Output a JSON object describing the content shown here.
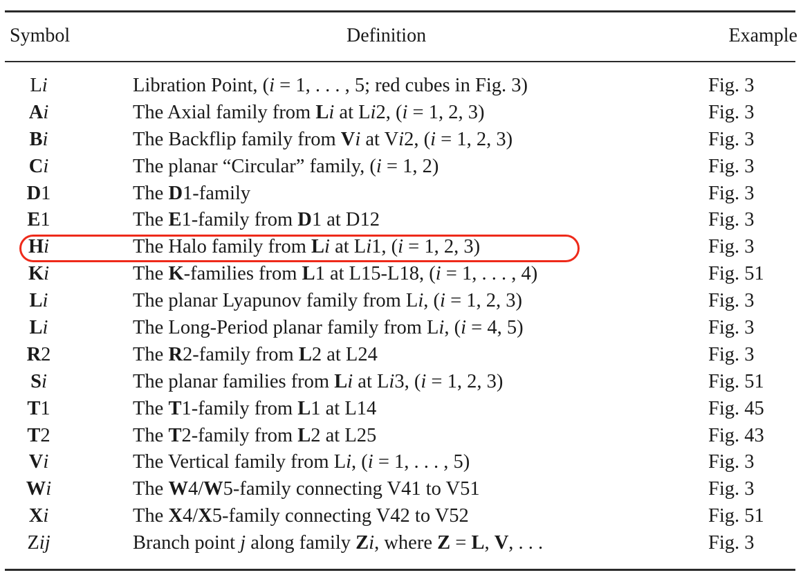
{
  "table": {
    "headers": {
      "symbol": "Symbol",
      "definition": "Definition",
      "example": "Example"
    },
    "highlight": {
      "row_index": 6,
      "color": "#ee2a1a"
    },
    "rows": [
      {
        "symbol": [
          {
            "t": "L",
            "s": "n"
          },
          {
            "t": "i",
            "s": "i"
          }
        ],
        "definition": [
          {
            "t": "Libration Point, (",
            "s": "n"
          },
          {
            "t": "i",
            "s": "i"
          },
          {
            "t": " = 1, . . . , 5; red cubes in Fig. 3)",
            "s": "n"
          }
        ],
        "example": "Fig. 3"
      },
      {
        "symbol": [
          {
            "t": "A",
            "s": "b"
          },
          {
            "t": "i",
            "s": "i"
          }
        ],
        "definition": [
          {
            "t": "The Axial family from ",
            "s": "n"
          },
          {
            "t": "L",
            "s": "b"
          },
          {
            "t": "i",
            "s": "i"
          },
          {
            "t": " at L",
            "s": "n"
          },
          {
            "t": "i",
            "s": "i"
          },
          {
            "t": "2, (",
            "s": "n"
          },
          {
            "t": "i",
            "s": "i"
          },
          {
            "t": " = 1, 2, 3)",
            "s": "n"
          }
        ],
        "example": "Fig. 3"
      },
      {
        "symbol": [
          {
            "t": "B",
            "s": "b"
          },
          {
            "t": "i",
            "s": "i"
          }
        ],
        "definition": [
          {
            "t": "The Backflip family from ",
            "s": "n"
          },
          {
            "t": "V",
            "s": "b"
          },
          {
            "t": "i",
            "s": "i"
          },
          {
            "t": " at V",
            "s": "n"
          },
          {
            "t": "i",
            "s": "i"
          },
          {
            "t": "2, (",
            "s": "n"
          },
          {
            "t": "i",
            "s": "i"
          },
          {
            "t": " = 1, 2, 3)",
            "s": "n"
          }
        ],
        "example": "Fig. 3"
      },
      {
        "symbol": [
          {
            "t": "C",
            "s": "b"
          },
          {
            "t": "i",
            "s": "i"
          }
        ],
        "definition": [
          {
            "t": "The planar “Circular” family, (",
            "s": "n"
          },
          {
            "t": "i",
            "s": "i"
          },
          {
            "t": " = 1, 2)",
            "s": "n"
          }
        ],
        "example": "Fig. 3"
      },
      {
        "symbol": [
          {
            "t": "D",
            "s": "b"
          },
          {
            "t": "1",
            "s": "n"
          }
        ],
        "definition": [
          {
            "t": "The ",
            "s": "n"
          },
          {
            "t": "D",
            "s": "b"
          },
          {
            "t": "1-family",
            "s": "n"
          }
        ],
        "example": "Fig. 3"
      },
      {
        "symbol": [
          {
            "t": "E",
            "s": "b"
          },
          {
            "t": "1",
            "s": "n"
          }
        ],
        "definition": [
          {
            "t": "The ",
            "s": "n"
          },
          {
            "t": "E",
            "s": "b"
          },
          {
            "t": "1-family from ",
            "s": "n"
          },
          {
            "t": "D",
            "s": "b"
          },
          {
            "t": "1 at D12",
            "s": "n"
          }
        ],
        "example": "Fig. 3"
      },
      {
        "symbol": [
          {
            "t": "H",
            "s": "b"
          },
          {
            "t": "i",
            "s": "i"
          }
        ],
        "definition": [
          {
            "t": "The Halo family from ",
            "s": "n"
          },
          {
            "t": "L",
            "s": "b"
          },
          {
            "t": "i",
            "s": "i"
          },
          {
            "t": " at L",
            "s": "n"
          },
          {
            "t": "i",
            "s": "i"
          },
          {
            "t": "1, (",
            "s": "n"
          },
          {
            "t": "i",
            "s": "i"
          },
          {
            "t": " = 1, 2, 3)",
            "s": "n"
          }
        ],
        "example": "Fig. 3"
      },
      {
        "symbol": [
          {
            "t": "K",
            "s": "b"
          },
          {
            "t": "i",
            "s": "i"
          }
        ],
        "definition": [
          {
            "t": "The ",
            "s": "n"
          },
          {
            "t": "K",
            "s": "b"
          },
          {
            "t": "-families from ",
            "s": "n"
          },
          {
            "t": "L",
            "s": "b"
          },
          {
            "t": "1 at L15-L18, (",
            "s": "n"
          },
          {
            "t": "i",
            "s": "i"
          },
          {
            "t": " = 1, . . . , 4)",
            "s": "n"
          }
        ],
        "example": "Fig. 51"
      },
      {
        "symbol": [
          {
            "t": "L",
            "s": "b"
          },
          {
            "t": "i",
            "s": "i"
          }
        ],
        "definition": [
          {
            "t": "The planar Lyapunov family from L",
            "s": "n"
          },
          {
            "t": "i",
            "s": "i"
          },
          {
            "t": ", (",
            "s": "n"
          },
          {
            "t": "i",
            "s": "i"
          },
          {
            "t": " = 1, 2, 3)",
            "s": "n"
          }
        ],
        "example": "Fig. 3"
      },
      {
        "symbol": [
          {
            "t": "L",
            "s": "b"
          },
          {
            "t": "i",
            "s": "i"
          }
        ],
        "definition": [
          {
            "t": "The Long-Period planar family from L",
            "s": "n"
          },
          {
            "t": "i",
            "s": "i"
          },
          {
            "t": ", (",
            "s": "n"
          },
          {
            "t": "i",
            "s": "i"
          },
          {
            "t": " = 4, 5)",
            "s": "n"
          }
        ],
        "example": "Fig. 3"
      },
      {
        "symbol": [
          {
            "t": "R",
            "s": "b"
          },
          {
            "t": "2",
            "s": "n"
          }
        ],
        "definition": [
          {
            "t": "The ",
            "s": "n"
          },
          {
            "t": "R",
            "s": "b"
          },
          {
            "t": "2-family from ",
            "s": "n"
          },
          {
            "t": "L",
            "s": "b"
          },
          {
            "t": "2 at L24",
            "s": "n"
          }
        ],
        "example": "Fig. 3"
      },
      {
        "symbol": [
          {
            "t": "S",
            "s": "b"
          },
          {
            "t": "i",
            "s": "i"
          }
        ],
        "definition": [
          {
            "t": "The planar families from ",
            "s": "n"
          },
          {
            "t": "L",
            "s": "b"
          },
          {
            "t": "i",
            "s": "i"
          },
          {
            "t": " at L",
            "s": "n"
          },
          {
            "t": "i",
            "s": "i"
          },
          {
            "t": "3, (",
            "s": "n"
          },
          {
            "t": "i",
            "s": "i"
          },
          {
            "t": " = 1, 2, 3)",
            "s": "n"
          }
        ],
        "example": "Fig. 51"
      },
      {
        "symbol": [
          {
            "t": "T",
            "s": "b"
          },
          {
            "t": "1",
            "s": "n"
          }
        ],
        "definition": [
          {
            "t": "The ",
            "s": "n"
          },
          {
            "t": "T",
            "s": "b"
          },
          {
            "t": "1-family from ",
            "s": "n"
          },
          {
            "t": "L",
            "s": "b"
          },
          {
            "t": "1 at L14",
            "s": "n"
          }
        ],
        "example": "Fig. 45"
      },
      {
        "symbol": [
          {
            "t": "T",
            "s": "b"
          },
          {
            "t": "2",
            "s": "n"
          }
        ],
        "definition": [
          {
            "t": "The ",
            "s": "n"
          },
          {
            "t": "T",
            "s": "b"
          },
          {
            "t": "2-family from ",
            "s": "n"
          },
          {
            "t": "L",
            "s": "b"
          },
          {
            "t": "2 at L25",
            "s": "n"
          }
        ],
        "example": "Fig. 43"
      },
      {
        "symbol": [
          {
            "t": "V",
            "s": "b"
          },
          {
            "t": "i",
            "s": "i"
          }
        ],
        "definition": [
          {
            "t": "The Vertical family from L",
            "s": "n"
          },
          {
            "t": "i",
            "s": "i"
          },
          {
            "t": ", (",
            "s": "n"
          },
          {
            "t": "i",
            "s": "i"
          },
          {
            "t": " = 1, . . . , 5)",
            "s": "n"
          }
        ],
        "example": "Fig. 3"
      },
      {
        "symbol": [
          {
            "t": "W",
            "s": "b"
          },
          {
            "t": "i",
            "s": "i"
          }
        ],
        "definition": [
          {
            "t": "The ",
            "s": "n"
          },
          {
            "t": "W",
            "s": "b"
          },
          {
            "t": "4/",
            "s": "n"
          },
          {
            "t": "W",
            "s": "b"
          },
          {
            "t": "5-family connecting V41 to V51",
            "s": "n"
          }
        ],
        "example": "Fig. 3"
      },
      {
        "symbol": [
          {
            "t": "X",
            "s": "b"
          },
          {
            "t": "i",
            "s": "i"
          }
        ],
        "definition": [
          {
            "t": "The ",
            "s": "n"
          },
          {
            "t": "X",
            "s": "b"
          },
          {
            "t": "4/",
            "s": "n"
          },
          {
            "t": "X",
            "s": "b"
          },
          {
            "t": "5-family connecting V42 to V52",
            "s": "n"
          }
        ],
        "example": "Fig. 51"
      },
      {
        "symbol": [
          {
            "t": "Z",
            "s": "n"
          },
          {
            "t": "ij",
            "s": "i"
          }
        ],
        "definition": [
          {
            "t": "Branch point ",
            "s": "n"
          },
          {
            "t": "j",
            "s": "i"
          },
          {
            "t": " along family ",
            "s": "n"
          },
          {
            "t": "Z",
            "s": "b"
          },
          {
            "t": "i",
            "s": "i"
          },
          {
            "t": ", where ",
            "s": "n"
          },
          {
            "t": "Z",
            "s": "b"
          },
          {
            "t": " = ",
            "s": "n"
          },
          {
            "t": "L",
            "s": "b"
          },
          {
            "t": ", ",
            "s": "n"
          },
          {
            "t": "V",
            "s": "b"
          },
          {
            "t": ", . . .",
            "s": "n"
          }
        ],
        "example": "Fig. 3"
      }
    ]
  }
}
